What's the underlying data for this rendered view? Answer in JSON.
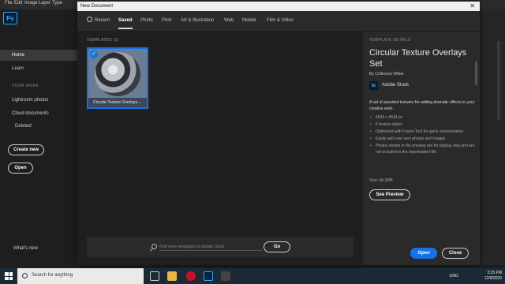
{
  "app": {
    "menu": [
      "File",
      "Edit",
      "Image",
      "Layer",
      "Type"
    ],
    "logo": "Ps"
  },
  "sidebar": {
    "home": "Home",
    "learn": "Learn",
    "your_work_header": "YOUR WORK",
    "lightroom": "Lightroom photos",
    "cloud": "Cloud documents",
    "deleted": "Deleted",
    "create_new": "Create new",
    "open": "Open",
    "whats_new": "What's new"
  },
  "dialog": {
    "title": "New Document",
    "close_glyph": "✕",
    "tabs": [
      "Recent",
      "Saved",
      "Photo",
      "Print",
      "Art & Illustration",
      "Web",
      "Mobile",
      "Film & Video"
    ],
    "active_tab": "Saved",
    "templates_header": "TEMPLATES  (1)",
    "template_card": {
      "label": "Circular Texture Overlays...",
      "check": "✓"
    },
    "search": {
      "placeholder": "Find more templates on Adobe Stock",
      "go_label": "Go"
    },
    "details": {
      "header": "TEMPLATE DETAILS",
      "title": "Circular Texture Overlays Set",
      "by": "By  Collective Offset",
      "stock_logo": "St",
      "stock_name": "Adobe Stock",
      "description": "A set of assorted textures for adding dramatic effects to your creative work.",
      "bullets": [
        "4534 x 4534 px",
        "6 texture styles",
        "Optimized with Frame Tool for quick customization",
        "Easily add your own photos and images",
        "Photos shown in the preview are for display only and are not included in the downloaded file"
      ],
      "size": "Size: 68.3MB",
      "preview_label": "See Preview",
      "open_label": "Open",
      "close_label": "Close"
    }
  },
  "taskbar": {
    "search_text": "Search for anything",
    "lang": "ENG",
    "time": "3:35 PM",
    "date": "12/8/2020"
  },
  "colors": {
    "accent": "#1473e6",
    "dialog_bg": "#323232",
    "app_bg": "#1e1e1e"
  }
}
